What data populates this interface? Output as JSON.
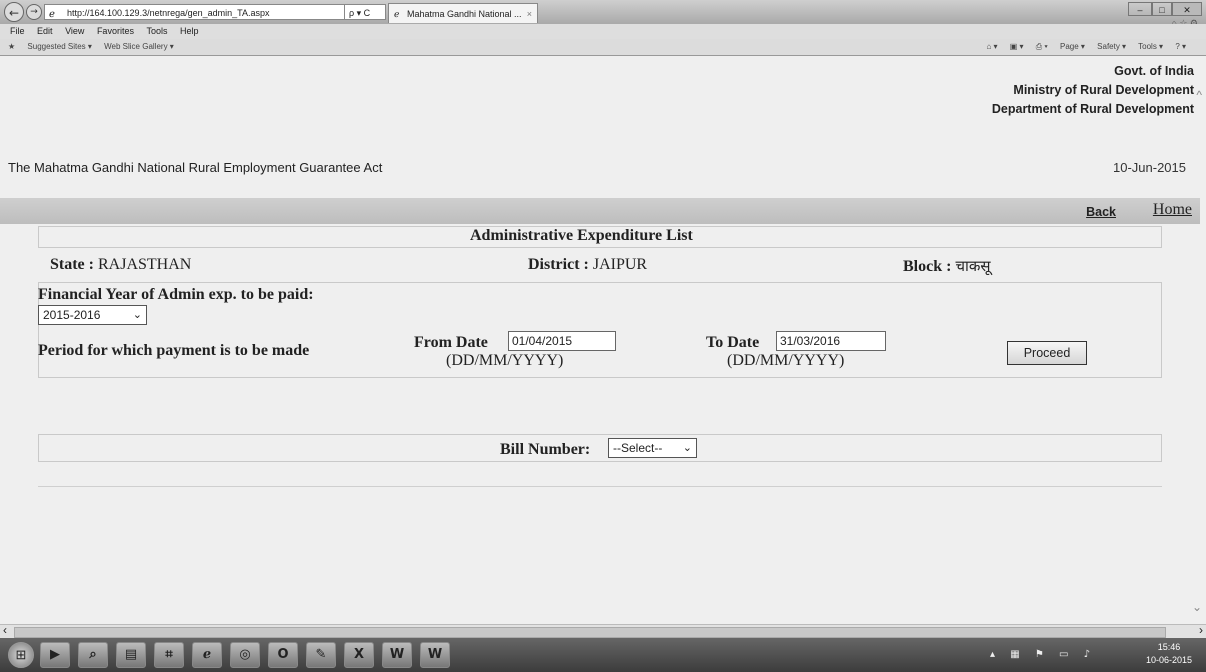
{
  "browser": {
    "address": "http://164.100.129.3/netnrega/gen_admin_TA.aspx",
    "address_controls": "ρ ▾ C",
    "tab_title": "Mahatma Gandhi National ...",
    "menu": [
      "File",
      "Edit",
      "View",
      "Favorites",
      "Tools",
      "Help"
    ],
    "favorites": [
      "Suggested Sites ▾",
      "Web Slice Gallery ▾"
    ],
    "command_bar": [
      "Page ▾",
      "Safety ▾",
      "Tools ▾"
    ]
  },
  "header": {
    "gov": "Govt. of India",
    "ministry": "Ministry of Rural Development",
    "department": "Department of Rural Development",
    "act": "The Mahatma Gandhi National Rural Employment Guarantee Act",
    "date": "10-Jun-2015"
  },
  "nav": {
    "back": "Back",
    "home": "Home"
  },
  "form": {
    "title": "Administrative Expenditure List",
    "state_label": "State :",
    "state_value": "RAJASTHAN",
    "district_label": "District :",
    "district_value": "JAIPUR",
    "block_label": "Block :",
    "block_value": "चाकसू",
    "fy_label": "Financial Year of Admin exp. to be paid:",
    "fy_value": "2015-2016",
    "period_label": "Period for which payment is to be made",
    "from_label": "From Date",
    "from_value": "01/04/2015",
    "to_label": "To Date",
    "to_value": "31/03/2016",
    "date_format": "(DD/MM/YYYY)",
    "proceed": "Proceed",
    "bill_label": "Bill Number:",
    "bill_value": "--Select--"
  },
  "taskbar": {
    "time": "15:46",
    "date": "10-06-2015"
  }
}
